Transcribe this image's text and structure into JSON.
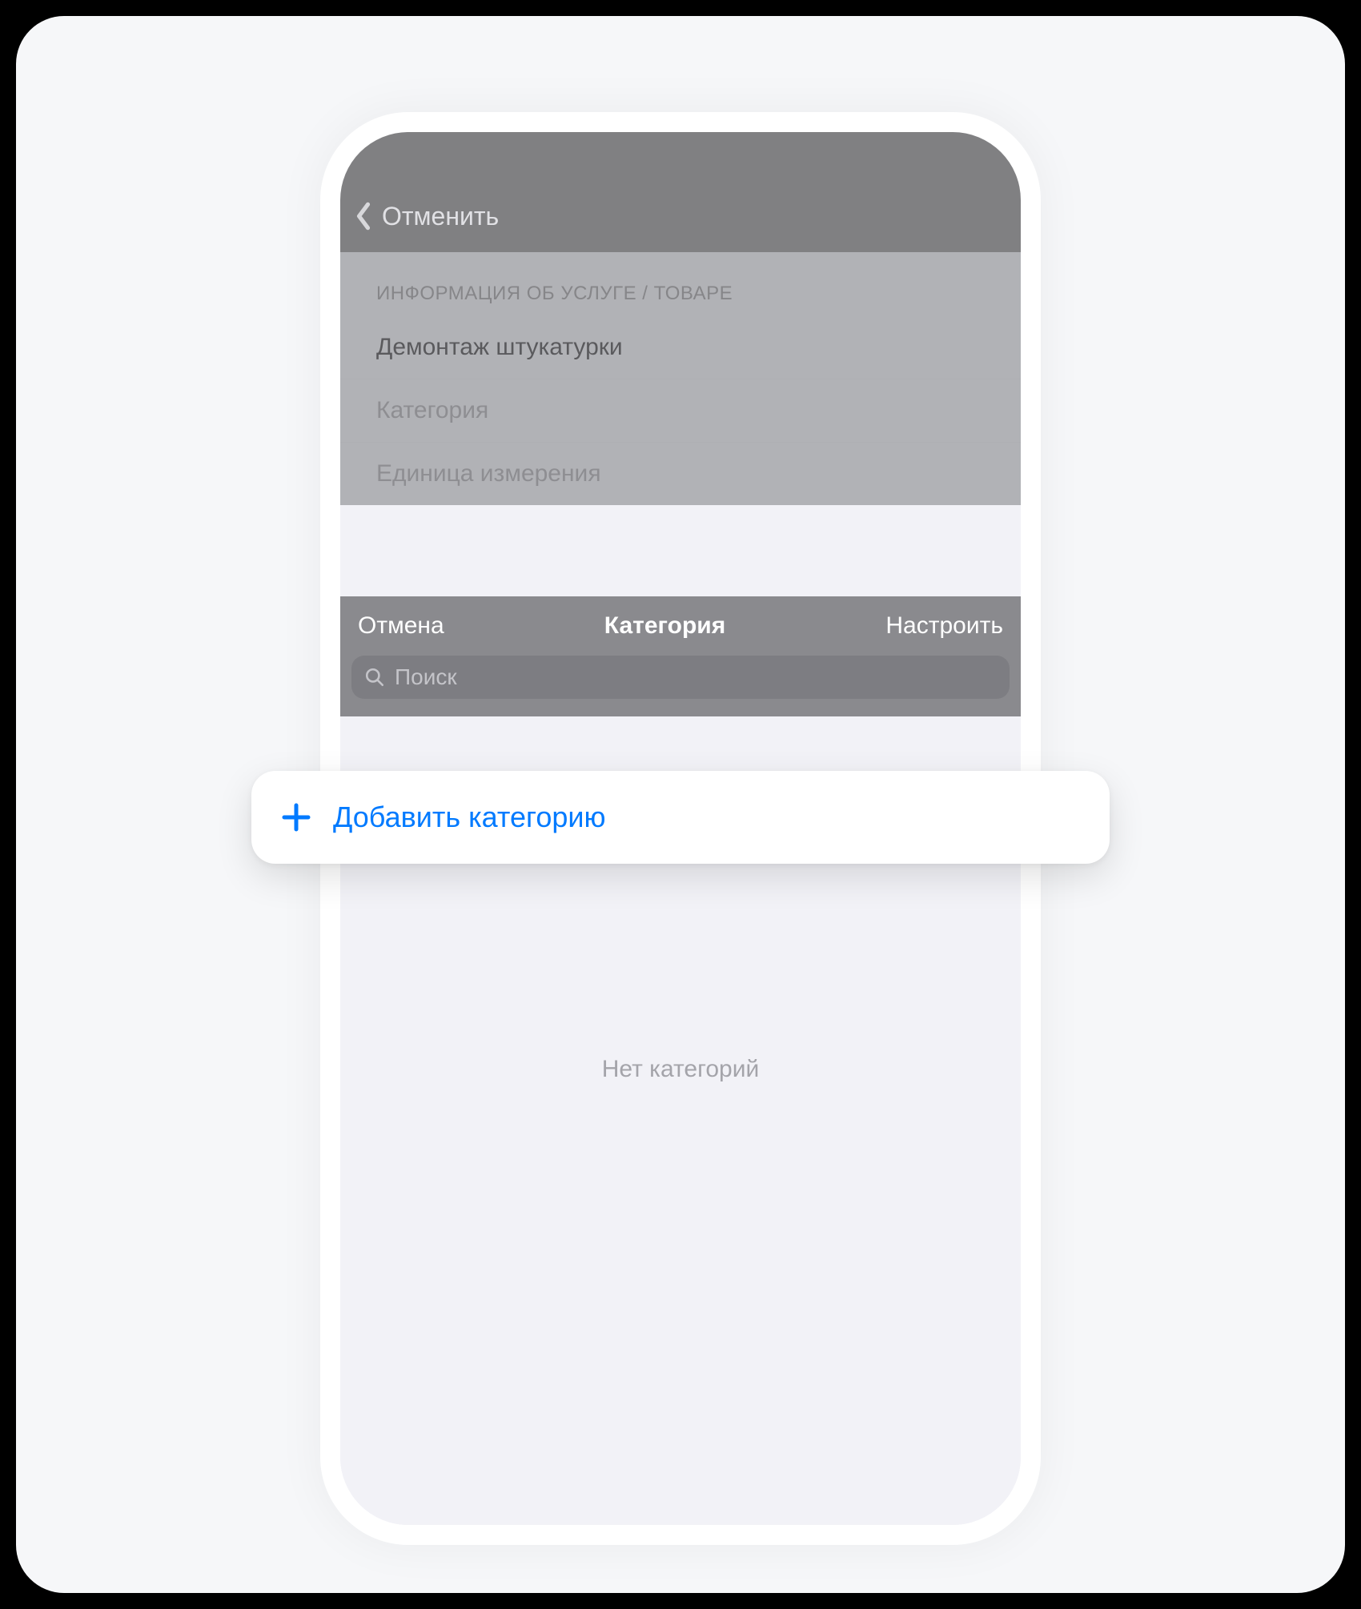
{
  "colors": {
    "accent": "#007aff"
  },
  "backgroundForm": {
    "cancelLabel": "Отменить",
    "sectionHeader": "ИНФОРМАЦИЯ ОБ УСЛУГЕ / ТОВАРЕ",
    "nameValue": "Демонтаж штукатурки",
    "categoryPlaceholder": "Категория",
    "unitPlaceholder": "Единица измерения"
  },
  "picker": {
    "cancelLabel": "Отмена",
    "title": "Категория",
    "configureLabel": "Настроить",
    "searchPlaceholder": "Поиск",
    "emptyState": "Нет категорий"
  },
  "addCategory": {
    "label": "Добавить категорию"
  }
}
